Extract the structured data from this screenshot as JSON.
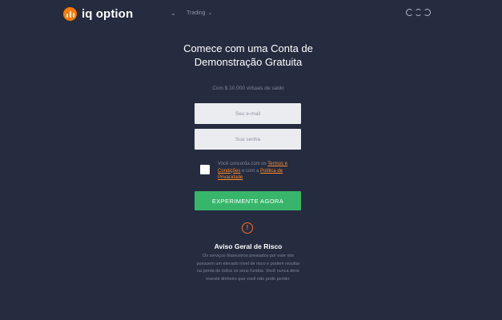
{
  "header": {
    "logo_text": "iq option",
    "nav_trading_label": "Trading",
    "icons": [
      "logo-icon",
      "chevron-down-icon",
      "language-icon"
    ]
  },
  "signup": {
    "headline": "Comece com uma Conta de Demonstração Gratuita",
    "subline": "Com $ 10.000 virtuais de saldo",
    "email_placeholder": "Seu e-mail",
    "password_placeholder": "Sua senha",
    "terms_prefix": "Você concorda com os ",
    "terms_link": "Termos e Condições",
    "terms_middle": " e com a ",
    "privacy_link": "Política de Privacidade",
    "cta_label": "EXPERIMENTE AGORA"
  },
  "risk": {
    "icon_glyph": "!",
    "title": "Aviso Geral de Risco",
    "text": "Os serviços financeiros prestados por este site possuem um elevado nível de risco e podem resultar na perda de todos os seus fundos. Você nunca deve investir dinheiro que você não pode perder."
  },
  "colors": {
    "background": "#252c3f",
    "accent_orange": "#ff7a00",
    "cta_green": "#37b56a",
    "field_bg": "#ebecf0"
  }
}
